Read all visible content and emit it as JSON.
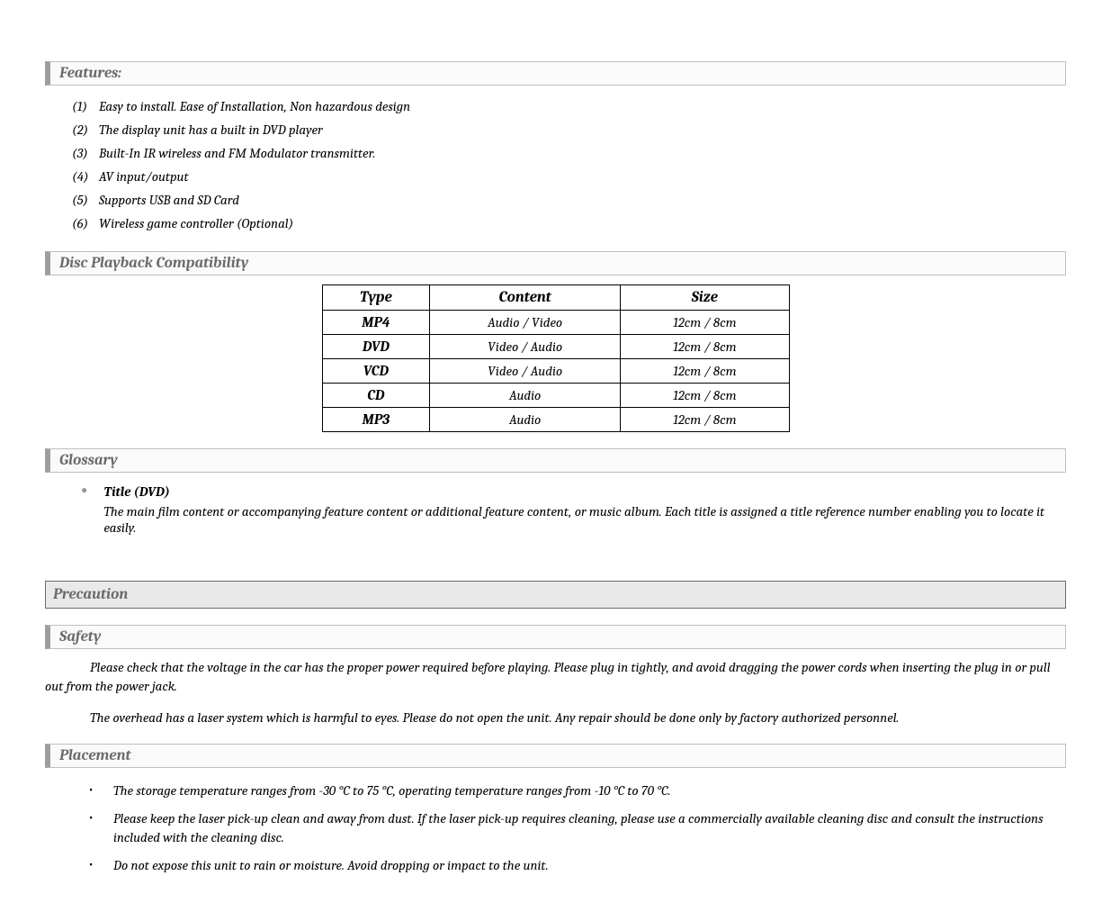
{
  "sections": {
    "features": {
      "title": "Features:",
      "items": [
        "Easy to install. Ease of Installation, Non hazardous design",
        "The display unit has a built in DVD player",
        "Built-In IR wireless and FM Modulator transmitter.",
        "AV input/output",
        "Supports USB and SD Card",
        "Wireless game controller (Optional)"
      ]
    },
    "compat": {
      "title": "Disc Playback Compatibility",
      "headers": [
        "Type",
        "Content",
        "Size"
      ],
      "rows": [
        {
          "type": "MP4",
          "content": "Audio / Video",
          "size": "12cm / 8cm"
        },
        {
          "type": "DVD",
          "content": "Video / Audio",
          "size": "12cm / 8cm"
        },
        {
          "type": "VCD",
          "content": "Video / Audio",
          "size": "12cm / 8cm"
        },
        {
          "type": "CD",
          "content": "Audio",
          "size": "12cm / 8cm"
        },
        {
          "type": "MP3",
          "content": "Audio",
          "size": "12cm / 8cm"
        }
      ]
    },
    "glossary": {
      "title": "Glossary",
      "items": [
        {
          "term": "Title (DVD)",
          "def": "The main film content or accompanying feature content or additional feature content, or music album. Each title is assigned a title reference number enabling you to locate it easily."
        }
      ]
    },
    "precaution": {
      "title": "Precaution"
    },
    "safety": {
      "title": "Safety",
      "paras": [
        "Please check that the voltage in the car has the proper power required before playing. Please plug in tightly, and avoid dragging the power cords when inserting the plug in or pull out from the power jack.",
        "The overhead has a laser system which is harmful to eyes. Please do not open the unit. Any repair should be done only by factory authorized personnel."
      ]
    },
    "placement": {
      "title": "Placement",
      "items": [
        "The storage temperature ranges from -30 °C to 75 °C, operating temperature ranges from -10 °C to 70 °C.",
        "Please keep the laser pick-up clean and away from dust. If the laser pick-up requires cleaning, please use a commercially available cleaning disc and consult the instructions included with the cleaning disc.",
        "Do not expose this unit to rain or moisture. Avoid dropping or impact to the unit."
      ]
    }
  }
}
